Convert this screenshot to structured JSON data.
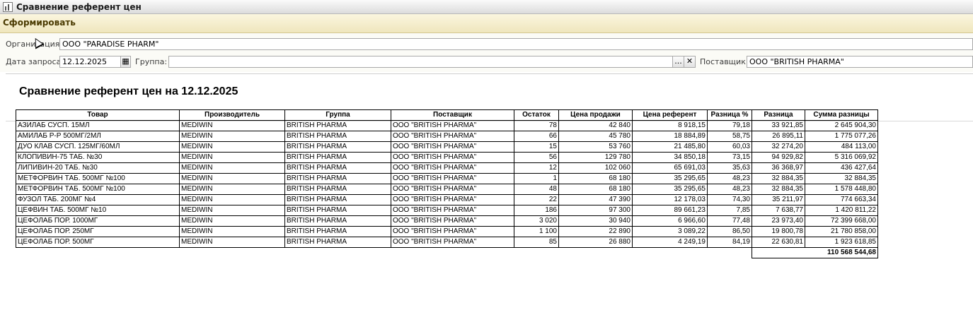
{
  "window": {
    "title": "Сравнение референт цен"
  },
  "toolbar": {
    "generate_label": "Сформировать"
  },
  "form": {
    "org_label": "Организация",
    "org_value": "ООО \"PARADISE PHARM\"",
    "date_label": "Дата запроса",
    "date_value": "12.12.2025",
    "group_label": "Группа:",
    "group_value": "",
    "supplier_label": "Поставщик:",
    "supplier_value": "ООО \"BRITISH PHARMA\"",
    "ellipsis": "...",
    "clear": "✕",
    "calendar_glyph": "▦"
  },
  "report": {
    "title": "Сравнение референт цен на 12.12.2025",
    "columns": [
      "Товар",
      "Производитель",
      "Группа",
      "Поставщик",
      "Остаток",
      "Цена продажи",
      "Цена референт",
      "Разница %",
      "Разница",
      "Сумма разницы"
    ],
    "rows": [
      [
        "АЗИЛАБ СУСП. 15МЛ",
        "MEDIWIN",
        "BRITISH PHARMA",
        "ООО \"BRITISH PHARMA\"",
        "78",
        "42 840",
        "8 918,15",
        "79,18",
        "33 921,85",
        "2 645 904,30"
      ],
      [
        "АМИЛАБ Р-Р 500МГ/2МЛ",
        "MEDIWIN",
        "BRITISH PHARMA",
        "ООО \"BRITISH PHARMA\"",
        "66",
        "45 780",
        "18 884,89",
        "58,75",
        "26 895,11",
        "1 775 077,26"
      ],
      [
        "ДУО КЛАВ СУСП. 125МГ/60МЛ",
        "MEDIWIN",
        "BRITISH PHARMA",
        "ООО \"BRITISH PHARMA\"",
        "15",
        "53 760",
        "21 485,80",
        "60,03",
        "32 274,20",
        "484 113,00"
      ],
      [
        "КЛОПИВИН-75 ТАБ. №30",
        "MEDIWIN",
        "BRITISH PHARMA",
        "ООО \"BRITISH PHARMA\"",
        "56",
        "129 780",
        "34 850,18",
        "73,15",
        "94 929,82",
        "5 316 069,92"
      ],
      [
        "ЛИПИВИН-20 ТАБ. №30",
        "MEDIWIN",
        "BRITISH PHARMA",
        "ООО \"BRITISH PHARMA\"",
        "12",
        "102 060",
        "65 691,03",
        "35,63",
        "36 368,97",
        "436 427,64"
      ],
      [
        "МЕТФОРВИН ТАБ. 500МГ №100",
        "MEDIWIN",
        "BRITISH PHARMA",
        "ООО \"BRITISH PHARMA\"",
        "1",
        "68 180",
        "35 295,65",
        "48,23",
        "32 884,35",
        "32 884,35"
      ],
      [
        "МЕТФОРВИН ТАБ. 500МГ №100",
        "MEDIWIN",
        "BRITISH PHARMA",
        "ООО \"BRITISH PHARMA\"",
        "48",
        "68 180",
        "35 295,65",
        "48,23",
        "32 884,35",
        "1 578 448,80"
      ],
      [
        "ФУЗОЛ ТАБ. 200МГ №4",
        "MEDIWIN",
        "BRITISH PHARMA",
        "ООО \"BRITISH PHARMA\"",
        "22",
        "47 390",
        "12 178,03",
        "74,30",
        "35 211,97",
        "774 663,34"
      ],
      [
        "ЦЕФВИН ТАБ. 500МГ №10",
        "MEDIWIN",
        "BRITISH PHARMA",
        "ООО \"BRITISH PHARMA\"",
        "186",
        "97 300",
        "89 661,23",
        "7,85",
        "7 638,77",
        "1 420 811,22"
      ],
      [
        "ЦЕФОЛАБ ПОР. 1000МГ",
        "MEDIWIN",
        "BRITISH PHARMA",
        "ООО \"BRITISH PHARMA\"",
        "3 020",
        "30 940",
        "6 966,60",
        "77,48",
        "23 973,40",
        "72 399 668,00"
      ],
      [
        "ЦЕФОЛАБ ПОР. 250МГ",
        "MEDIWIN",
        "BRITISH PHARMA",
        "ООО \"BRITISH PHARMA\"",
        "1 100",
        "22 890",
        "3 089,22",
        "86,50",
        "19 800,78",
        "21 780 858,00"
      ],
      [
        "ЦЕФОЛАБ ПОР. 500МГ",
        "MEDIWIN",
        "BRITISH PHARMA",
        "ООО \"BRITISH PHARMA\"",
        "85",
        "26 880",
        "4 249,19",
        "84,19",
        "22 630,81",
        "1 923 618,85"
      ]
    ],
    "total": "110 568 544,68"
  }
}
